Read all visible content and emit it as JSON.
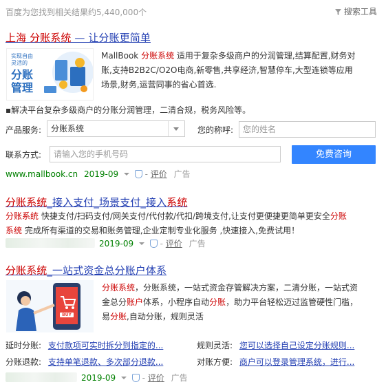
{
  "top": {
    "result_count": "百度为您找到相关结果约5,440,000个",
    "tools_label": "搜索工具"
  },
  "r1": {
    "title_parts": [
      "上海 ",
      "分账系统",
      " — 让分账更简单"
    ],
    "img_lines": [
      "实现自由",
      "灵活的",
      "分账",
      "管理"
    ],
    "desc_lines": [
      [
        "MallBook ",
        "分账系统",
        " 适用于复杂多级商户的分润管理,结算配置,财务对"
      ],
      [
        "账,支持B2B2C/O2O电商,新零售,共享经济,智慧停车,大型连锁等应用"
      ],
      [
        "场景,财务,运营同事的省心首选."
      ]
    ],
    "note": "▪解决平台复杂多级商户的分账分润管理，二清合规，税务风险等。",
    "form": {
      "product_label": "产品服务:",
      "product_value": "分账系统",
      "name_label": "您的称呼:",
      "name_placeholder": "您的姓名",
      "contact_label": "联系方式:",
      "phone_placeholder": "请输入您的手机号码",
      "submit": "免费咨询"
    },
    "meta": {
      "url": "www.mallbook.cn",
      "date": "2019-09",
      "review": "评价",
      "ad": "广告"
    }
  },
  "r2": {
    "title_parts": [
      "分账系统",
      "_接入支付_场景支付_接入",
      "系统"
    ],
    "desc_lines": [
      [
        "分账系统",
        " 快捷支付/扫码支付/网关支付/代付款/代扣/跨境支付,让支付更便捷更简单更安全",
        "分账"
      ],
      [
        "系统",
        " 完成所有渠道的交易和账务管理,企业定制专业化服务 ,快速接入,免费试用！"
      ]
    ],
    "meta": {
      "date": "2019-09",
      "review": "评价",
      "ad": "广告"
    }
  },
  "r3": {
    "title_parts": [
      "分账系统",
      "_一站式资金总分账户体系"
    ],
    "phone_label": "BUY",
    "desc_lines": [
      [
        "分账系统",
        "，分账系统，一站式资金存管解决方案，二清分账，一站式资"
      ],
      [
        "金总分",
        "账户",
        "体系，小程序自动",
        "分账",
        "，助力平台轻松迈过监管硬性门槛，"
      ],
      [
        "易",
        "分账",
        ",自动分账，规则灵活"
      ]
    ],
    "sitelinks": [
      {
        "label": "延时分账:",
        "text": "支付款项可实时拆分到指定的..."
      },
      {
        "label": "规则灵活:",
        "text": "您可以选择自己设定分账规则..."
      },
      {
        "label": "分账退款:",
        "text": "支持单笔退款、多次部分退款..."
      },
      {
        "label": "对账方便:",
        "text": "商户可以登录管理系统，进行..."
      }
    ],
    "meta": {
      "date": "2019-09",
      "review": "评价",
      "ad": "广告"
    }
  }
}
